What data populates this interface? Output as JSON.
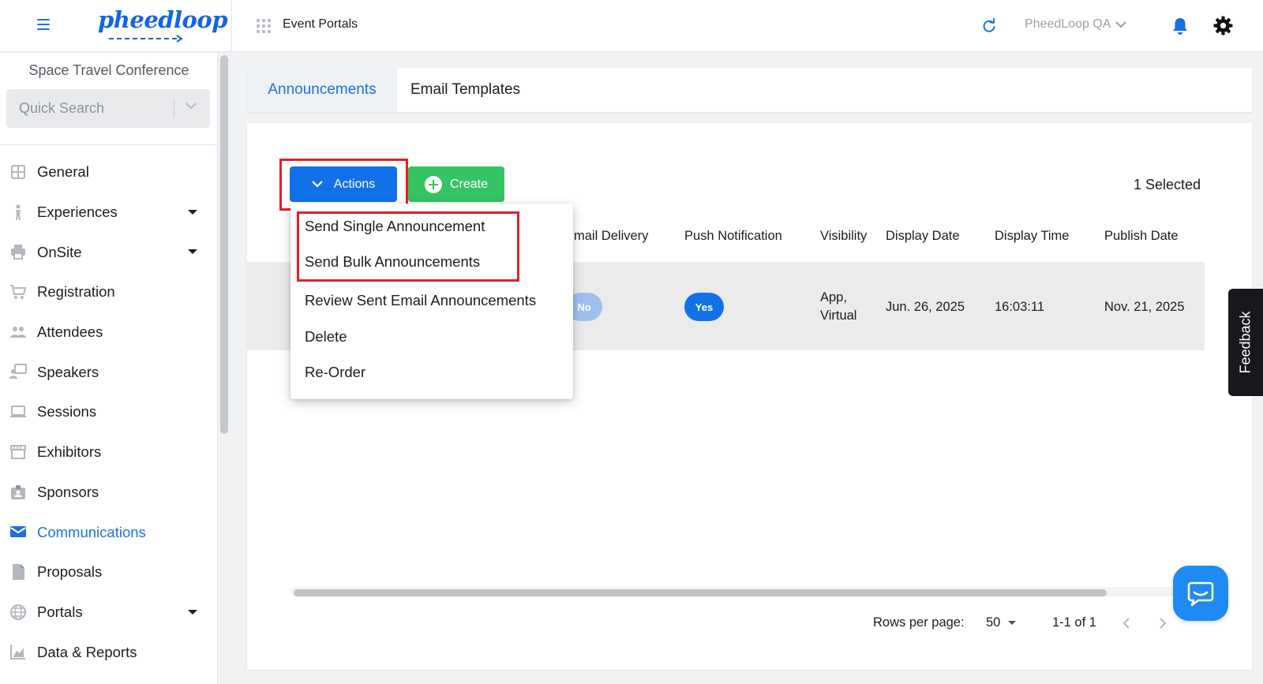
{
  "app": {
    "logo_text": "pheedloop",
    "section_title": "Event Portals"
  },
  "header": {
    "org_name": "PheedLoop QA"
  },
  "sidebar": {
    "event_name": "Space Travel Conference",
    "search_placeholder": "Quick Search",
    "items": [
      {
        "label": "General",
        "icon": "grid-icon",
        "has_caret": false
      },
      {
        "label": "Experiences",
        "icon": "person-icon",
        "has_caret": true
      },
      {
        "label": "OnSite",
        "icon": "printer-icon",
        "has_caret": true
      },
      {
        "label": "Registration",
        "icon": "cart-icon",
        "has_caret": false
      },
      {
        "label": "Attendees",
        "icon": "people-icon",
        "has_caret": false
      },
      {
        "label": "Speakers",
        "icon": "presenter-icon",
        "has_caret": false
      },
      {
        "label": "Sessions",
        "icon": "laptop-icon",
        "has_caret": false
      },
      {
        "label": "Exhibitors",
        "icon": "storefront-icon",
        "has_caret": false
      },
      {
        "label": "Sponsors",
        "icon": "badge-icon",
        "has_caret": false
      },
      {
        "label": "Communications",
        "icon": "mail-icon",
        "has_caret": false,
        "active": true
      },
      {
        "label": "Proposals",
        "icon": "document-icon",
        "has_caret": false
      },
      {
        "label": "Portals",
        "icon": "globe-icon",
        "has_caret": true
      },
      {
        "label": "Data & Reports",
        "icon": "chart-icon",
        "has_caret": false
      }
    ]
  },
  "tabs": {
    "announcements": "Announcements",
    "email_templates": "Email Templates"
  },
  "toolbar": {
    "actions_label": "Actions",
    "create_label": "Create",
    "selected_count": "1 Selected"
  },
  "actions_menu": {
    "items": [
      "Send Single Announcement",
      "Send Bulk Announcements",
      "Review Sent Email Announcements",
      "Delete",
      "Re-Order"
    ]
  },
  "table": {
    "columns": [
      "mail Delivery",
      "Push Notification",
      "Visibility",
      "Display Date",
      "Display Time",
      "Publish Date"
    ],
    "rows": [
      {
        "email_delivery": "No",
        "push_notification": "Yes",
        "visibility_line1": "App,",
        "visibility_line2": "Virtual",
        "display_date": "Jun. 26, 2025",
        "display_time": "16:03:11",
        "publish_date": "Nov. 21, 2025"
      }
    ]
  },
  "pagination": {
    "rows_per_page_label": "Rows per page:",
    "rows_per_page_value": "50",
    "range_label": "1-1 of 1"
  },
  "feedback": {
    "label": "Feedback"
  },
  "colors": {
    "primary": "#1271e8",
    "create_green": "#34c463",
    "highlight_red": "#e4202a",
    "row_bg": "#ebebec"
  }
}
